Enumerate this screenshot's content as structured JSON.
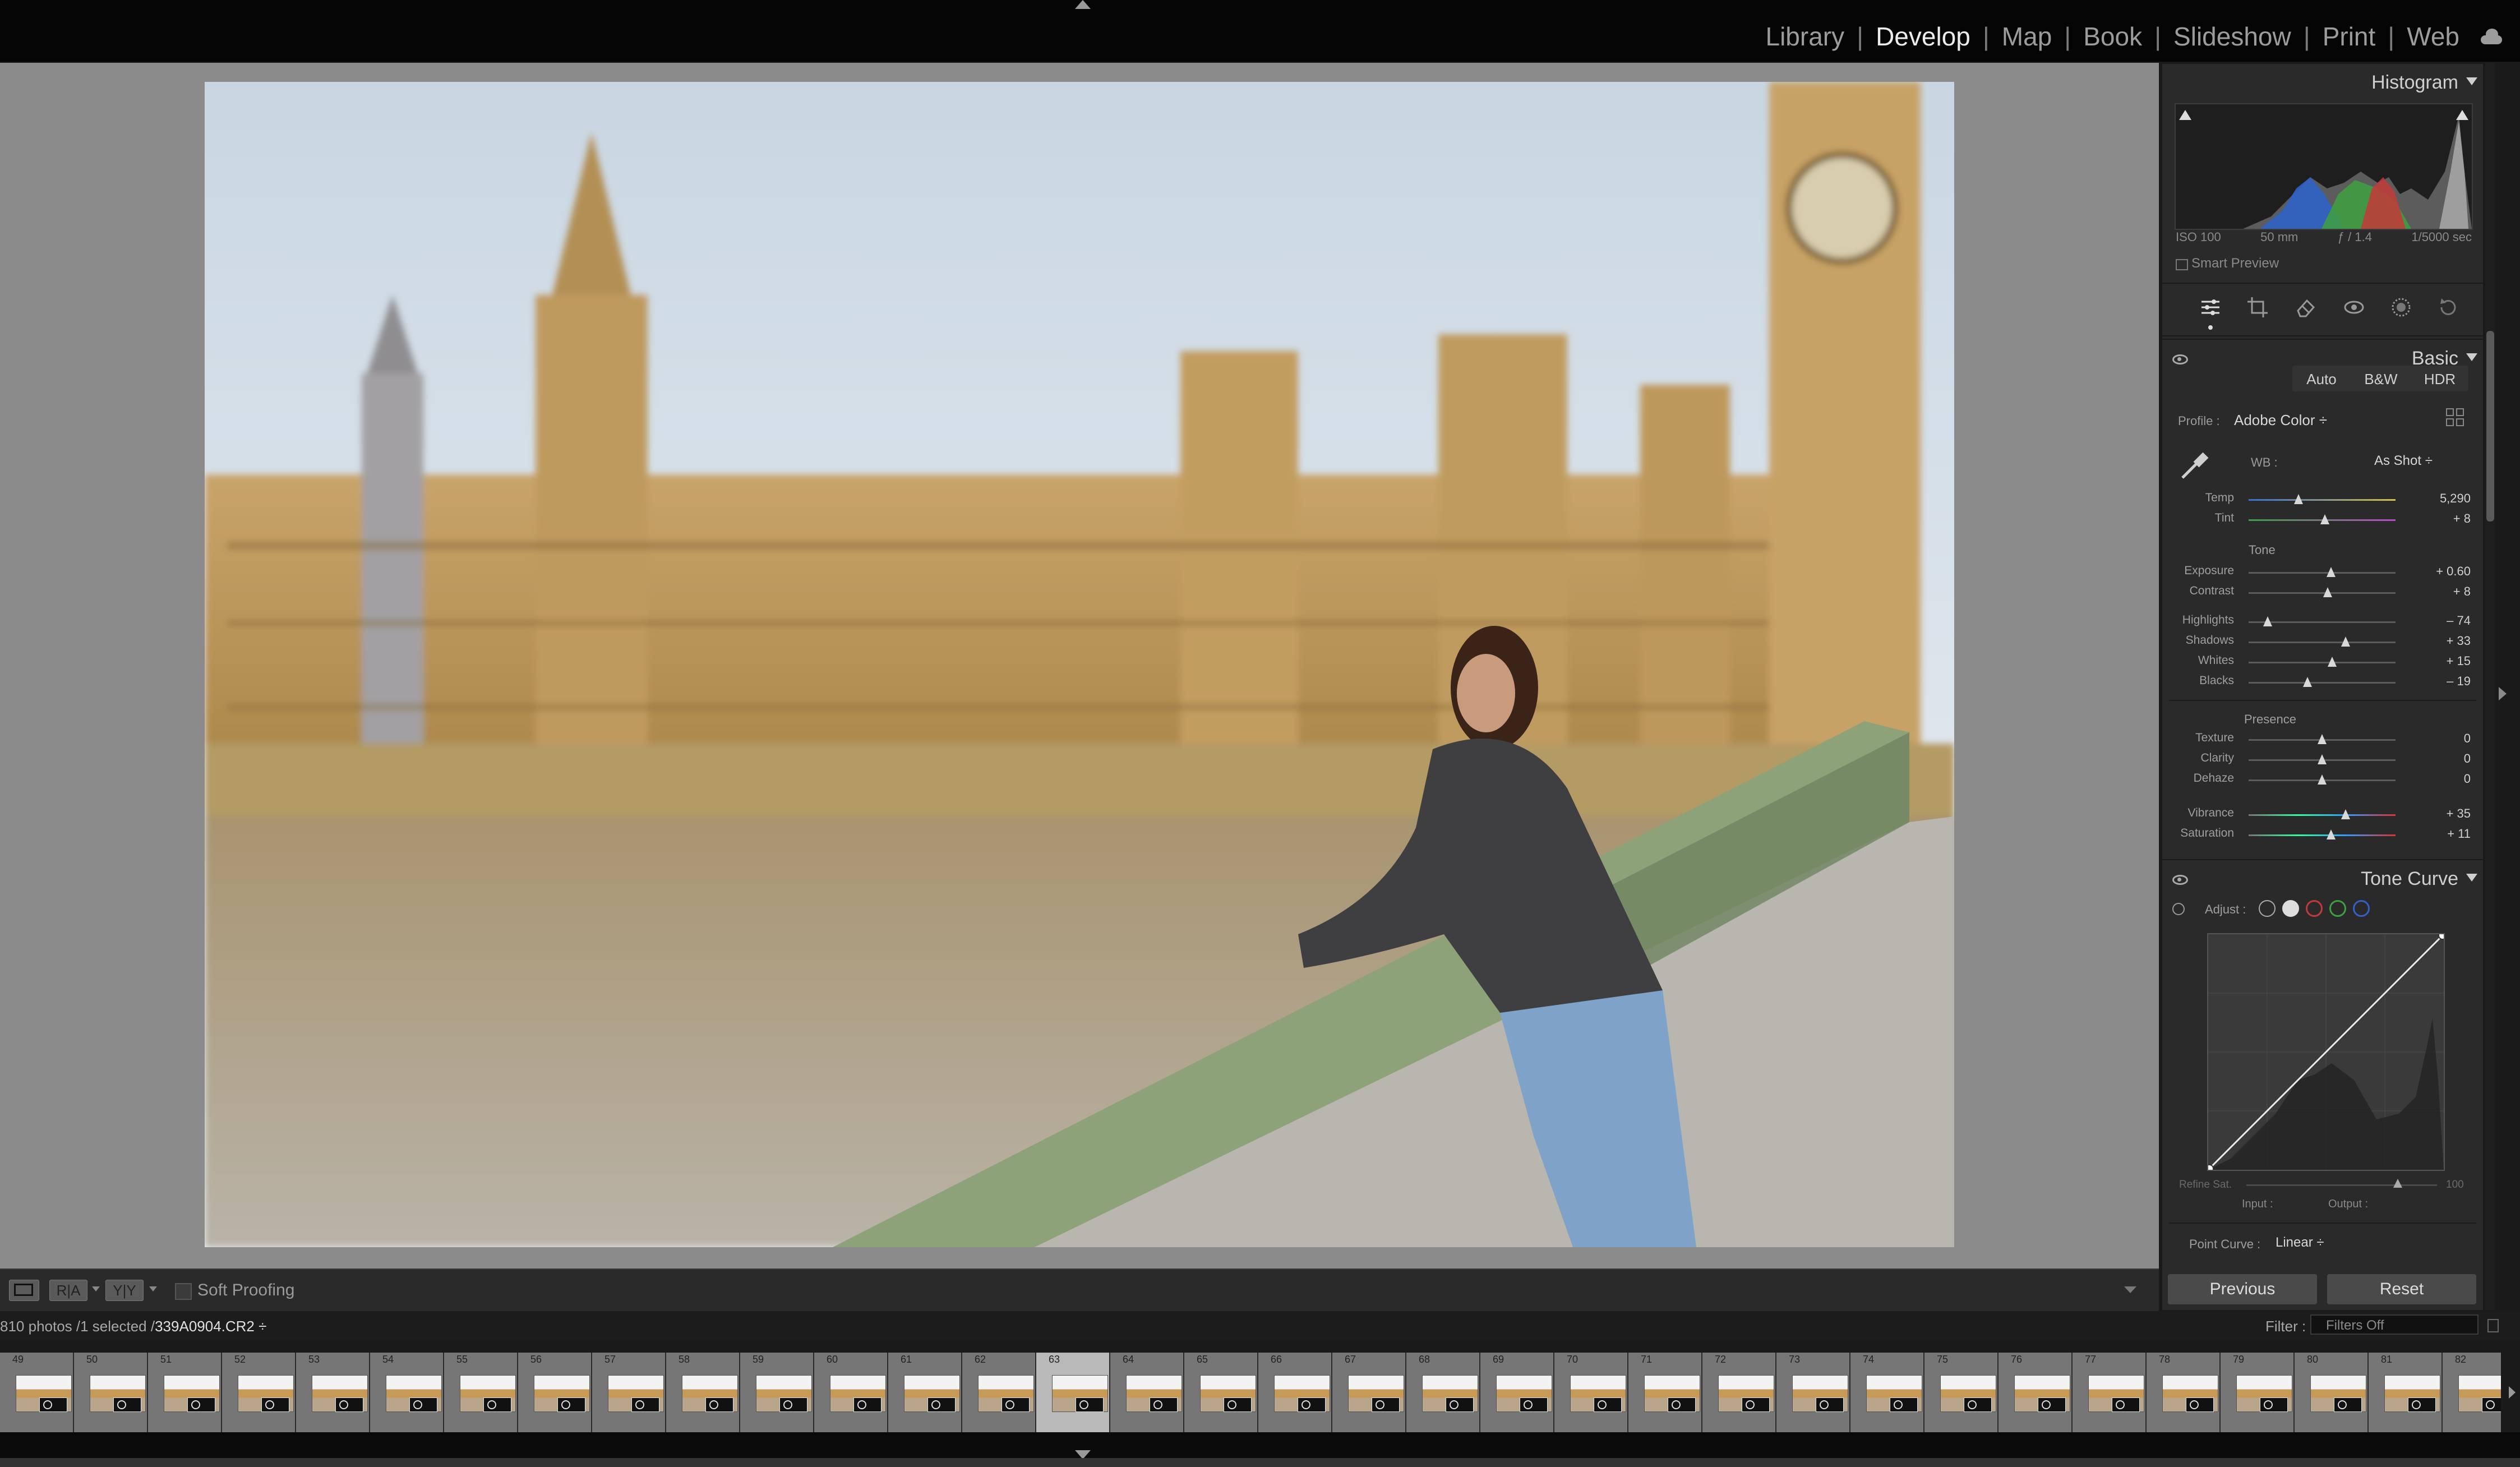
{
  "modules": [
    {
      "label": "Library",
      "active": false
    },
    {
      "label": "Develop",
      "active": true
    },
    {
      "label": "Map",
      "active": false
    },
    {
      "label": "Book",
      "active": false
    },
    {
      "label": "Slideshow",
      "active": false
    },
    {
      "label": "Print",
      "active": false
    },
    {
      "label": "Web",
      "active": false
    }
  ],
  "toolbar": {
    "ra_label": "R|A",
    "yy_label": "Y|Y",
    "soft_proofing_label": "Soft Proofing"
  },
  "histogram": {
    "title": "Histogram",
    "iso": "ISO 100",
    "focal": "50 mm",
    "aperture": "ƒ / 1.4",
    "shutter": "1/5000 sec",
    "smart_preview_label": "Smart Preview"
  },
  "basic": {
    "title": "Basic",
    "buttons": [
      "Auto",
      "B&W",
      "HDR"
    ],
    "profile_label": "Profile :",
    "profile_value": "Adobe Color ÷",
    "wb_label": "WB :",
    "wb_value": "As Shot ÷",
    "tone_label": "Tone",
    "presence_label": "Presence",
    "sliders": [
      {
        "label": "Temp",
        "value": "5,290",
        "pos": 0.34
      },
      {
        "label": "Tint",
        "value": "+ 8",
        "pos": 0.52
      },
      {
        "label": "Exposure",
        "value": "+ 0.60",
        "pos": 0.56
      },
      {
        "label": "Contrast",
        "value": "+ 8",
        "pos": 0.54
      },
      {
        "label": "Highlights",
        "value": "– 74",
        "pos": 0.13
      },
      {
        "label": "Shadows",
        "value": "+ 33",
        "pos": 0.66
      },
      {
        "label": "Whites",
        "value": "+ 15",
        "pos": 0.57
      },
      {
        "label": "Blacks",
        "value": "– 19",
        "pos": 0.4
      },
      {
        "label": "Texture",
        "value": "0",
        "pos": 0.5
      },
      {
        "label": "Clarity",
        "value": "0",
        "pos": 0.5
      },
      {
        "label": "Dehaze",
        "value": "0",
        "pos": 0.5
      },
      {
        "label": "Vibrance",
        "value": "+ 35",
        "pos": 0.66
      },
      {
        "label": "Saturation",
        "value": "+ 11",
        "pos": 0.56
      }
    ]
  },
  "tone_curve": {
    "title": "Tone Curve",
    "adjust_label": "Adjust :",
    "refine_label": "Refine Sat.",
    "refine_value": "100",
    "input_label": "Input :",
    "output_label": "Output :",
    "point_curve_label": "Point Curve :",
    "point_curve_value": "Linear ÷"
  },
  "panel_buttons": {
    "previous": "Previous",
    "reset": "Reset"
  },
  "filmstrip": {
    "info_prefix": "810 photos /1 selected /",
    "filename": "339A0904.CR2 ÷",
    "filter_label": "Filter :",
    "filter_value": "Filters Off",
    "numbers": [
      "49",
      "50",
      "51",
      "52",
      "53",
      "54",
      "55",
      "56",
      "57",
      "58",
      "59",
      "60",
      "61",
      "62",
      "63",
      "64",
      "65",
      "66",
      "67",
      "68",
      "69",
      "70",
      "71",
      "72",
      "73",
      "74",
      "75",
      "76",
      "77",
      "78",
      "79",
      "80",
      "81",
      "82"
    ],
    "selected_index": 14
  },
  "colors": {
    "accent_highlight": "#ececec",
    "panel_bg": "#2a2a2a",
    "canvas_bg": "#8b8b8b"
  }
}
